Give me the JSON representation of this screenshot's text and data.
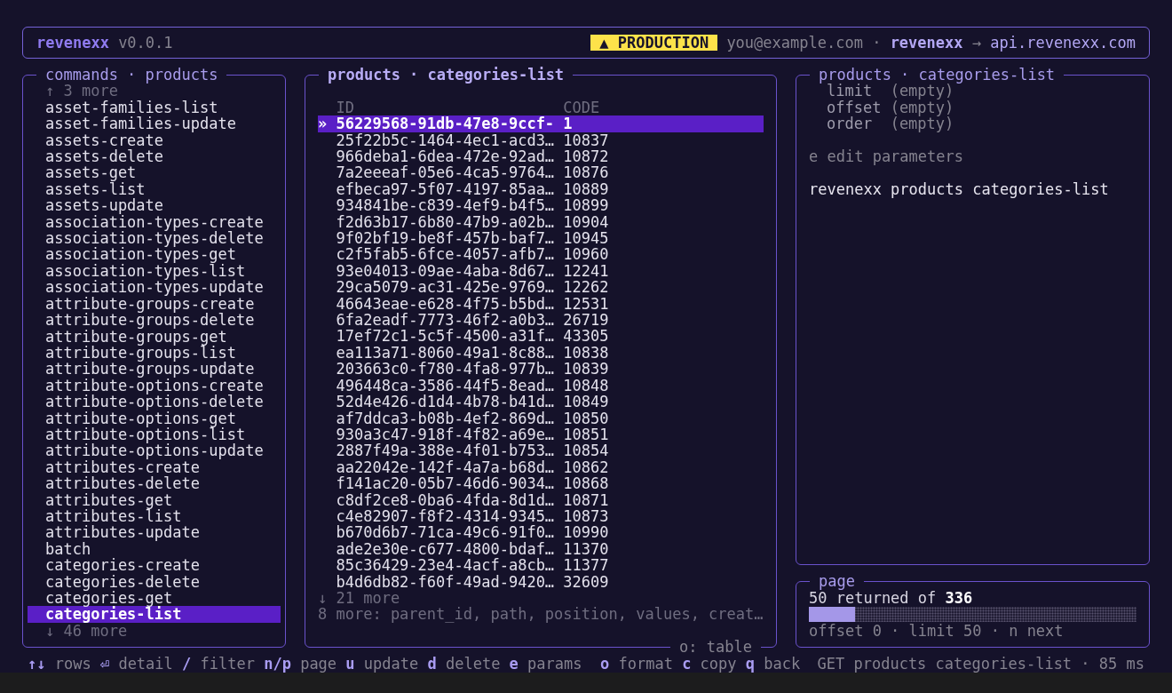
{
  "header": {
    "brand": "revenexx",
    "version": "v0.0.1",
    "environment_badge": "▲ PRODUCTION",
    "user": "you@example.com",
    "separator": "·",
    "profile": "revenexx",
    "arrow": "→",
    "host": "api.revenexx.com"
  },
  "commands_panel": {
    "title": "commands · products",
    "more_above": "↑ 3 more",
    "items": [
      {
        "label": "asset-families-list",
        "selected": false
      },
      {
        "label": "asset-families-update",
        "selected": false
      },
      {
        "label": "assets-create",
        "selected": false
      },
      {
        "label": "assets-delete",
        "selected": false
      },
      {
        "label": "assets-get",
        "selected": false
      },
      {
        "label": "assets-list",
        "selected": false
      },
      {
        "label": "assets-update",
        "selected": false
      },
      {
        "label": "association-types-create",
        "selected": false
      },
      {
        "label": "association-types-delete",
        "selected": false
      },
      {
        "label": "association-types-get",
        "selected": false
      },
      {
        "label": "association-types-list",
        "selected": false
      },
      {
        "label": "association-types-update",
        "selected": false
      },
      {
        "label": "attribute-groups-create",
        "selected": false
      },
      {
        "label": "attribute-groups-delete",
        "selected": false
      },
      {
        "label": "attribute-groups-get",
        "selected": false
      },
      {
        "label": "attribute-groups-list",
        "selected": false
      },
      {
        "label": "attribute-groups-update",
        "selected": false
      },
      {
        "label": "attribute-options-create",
        "selected": false
      },
      {
        "label": "attribute-options-delete",
        "selected": false
      },
      {
        "label": "attribute-options-get",
        "selected": false
      },
      {
        "label": "attribute-options-list",
        "selected": false
      },
      {
        "label": "attribute-options-update",
        "selected": false
      },
      {
        "label": "attributes-create",
        "selected": false
      },
      {
        "label": "attributes-delete",
        "selected": false
      },
      {
        "label": "attributes-get",
        "selected": false
      },
      {
        "label": "attributes-list",
        "selected": false
      },
      {
        "label": "attributes-update",
        "selected": false
      },
      {
        "label": "batch",
        "selected": false
      },
      {
        "label": "categories-create",
        "selected": false
      },
      {
        "label": "categories-delete",
        "selected": false
      },
      {
        "label": "categories-get",
        "selected": false
      },
      {
        "label": "categories-list",
        "selected": true
      }
    ],
    "more_below": "↓ 46 more"
  },
  "results_panel": {
    "title": "products · categories-list",
    "cursor": "»",
    "columns": [
      "ID",
      "CODE"
    ],
    "rows": [
      {
        "id": "56229568-91db-47e8-9ccf-",
        "code": "1",
        "selected": true
      },
      {
        "id": "25f22b5c-1464-4ec1-acd3…",
        "code": "10837",
        "selected": false
      },
      {
        "id": "966deba1-6dea-472e-92ad…",
        "code": "10872",
        "selected": false
      },
      {
        "id": "7a2eeeaf-05e6-4ca5-9764…",
        "code": "10876",
        "selected": false
      },
      {
        "id": "efbeca97-5f07-4197-85aa…",
        "code": "10889",
        "selected": false
      },
      {
        "id": "934841be-c839-4ef9-b4f5…",
        "code": "10899",
        "selected": false
      },
      {
        "id": "f2d63b17-6b80-47b9-a02b…",
        "code": "10904",
        "selected": false
      },
      {
        "id": "9f02bf19-be8f-457b-baf7…",
        "code": "10945",
        "selected": false
      },
      {
        "id": "c2f5fab5-6fce-4057-afb7…",
        "code": "10960",
        "selected": false
      },
      {
        "id": "93e04013-09ae-4aba-8d67…",
        "code": "12241",
        "selected": false
      },
      {
        "id": "29ca5079-ac31-425e-9769…",
        "code": "12262",
        "selected": false
      },
      {
        "id": "46643eae-e628-4f75-b5bd…",
        "code": "12531",
        "selected": false
      },
      {
        "id": "6fa2eadf-7773-46f2-a0b3…",
        "code": "26719",
        "selected": false
      },
      {
        "id": "17ef72c1-5c5f-4500-a31f…",
        "code": "43305",
        "selected": false
      },
      {
        "id": "ea113a71-8060-49a1-8c88…",
        "code": "10838",
        "selected": false
      },
      {
        "id": "203663c0-f780-4fa8-977b…",
        "code": "10839",
        "selected": false
      },
      {
        "id": "496448ca-3586-44f5-8ead…",
        "code": "10848",
        "selected": false
      },
      {
        "id": "52d4e426-d1d4-4b78-b41d…",
        "code": "10849",
        "selected": false
      },
      {
        "id": "af7ddca3-b08b-4ef2-869d…",
        "code": "10850",
        "selected": false
      },
      {
        "id": "930a3c47-918f-4f82-a69e…",
        "code": "10851",
        "selected": false
      },
      {
        "id": "2887f49a-388e-4f01-b753…",
        "code": "10854",
        "selected": false
      },
      {
        "id": "aa22042e-142f-4a7a-b68d…",
        "code": "10862",
        "selected": false
      },
      {
        "id": "f141ac20-05b7-46d6-9034…",
        "code": "10868",
        "selected": false
      },
      {
        "id": "c8df2ce8-0ba6-4fda-8d1d…",
        "code": "10871",
        "selected": false
      },
      {
        "id": "c4e82907-f8f2-4314-9345…",
        "code": "10873",
        "selected": false
      },
      {
        "id": "b670d6b7-71ca-49c6-91f0…",
        "code": "10990",
        "selected": false
      },
      {
        "id": "ade2e30e-c677-4800-bdaf…",
        "code": "11370",
        "selected": false
      },
      {
        "id": "85c36429-23e4-4acf-a8cb…",
        "code": "11377",
        "selected": false
      },
      {
        "id": "b4d6db82-f60f-49ad-9420…",
        "code": "32609",
        "selected": false
      }
    ],
    "more_below": "↓ 21 more",
    "hidden_columns": "8 more: parent_id, path, position, values, creat…",
    "format_label": "o: table"
  },
  "params_panel": {
    "title": "products · categories-list",
    "params": [
      {
        "name": "limit",
        "value": "(empty)"
      },
      {
        "name": "offset",
        "value": "(empty)"
      },
      {
        "name": "order",
        "value": "(empty)"
      }
    ],
    "hint": "e edit parameters",
    "command_preview": "revenexx products categories-list"
  },
  "page_panel": {
    "title": "page",
    "summary": "50 returned of **336**",
    "level": 0.14,
    "footer": "offset 0 · limit 50 · n next"
  },
  "status_bar": {
    "hint_groups": [
      [
        {
          "key": "↑↓",
          "label": "rows"
        },
        {
          "key": "⏎",
          "label": "detail"
        },
        {
          "key": "/",
          "label": "filter"
        },
        {
          "key": "n/p",
          "label": "page"
        },
        {
          "key": "u",
          "label": "update"
        },
        {
          "key": "d",
          "label": "delete"
        },
        {
          "key": "e",
          "label": "params"
        }
      ],
      [
        {
          "key": "o",
          "label": "format"
        },
        {
          "key": "c",
          "label": "copy"
        },
        {
          "key": "q",
          "label": "back"
        }
      ]
    ],
    "request": "GET products categories-list · 85 ms"
  }
}
